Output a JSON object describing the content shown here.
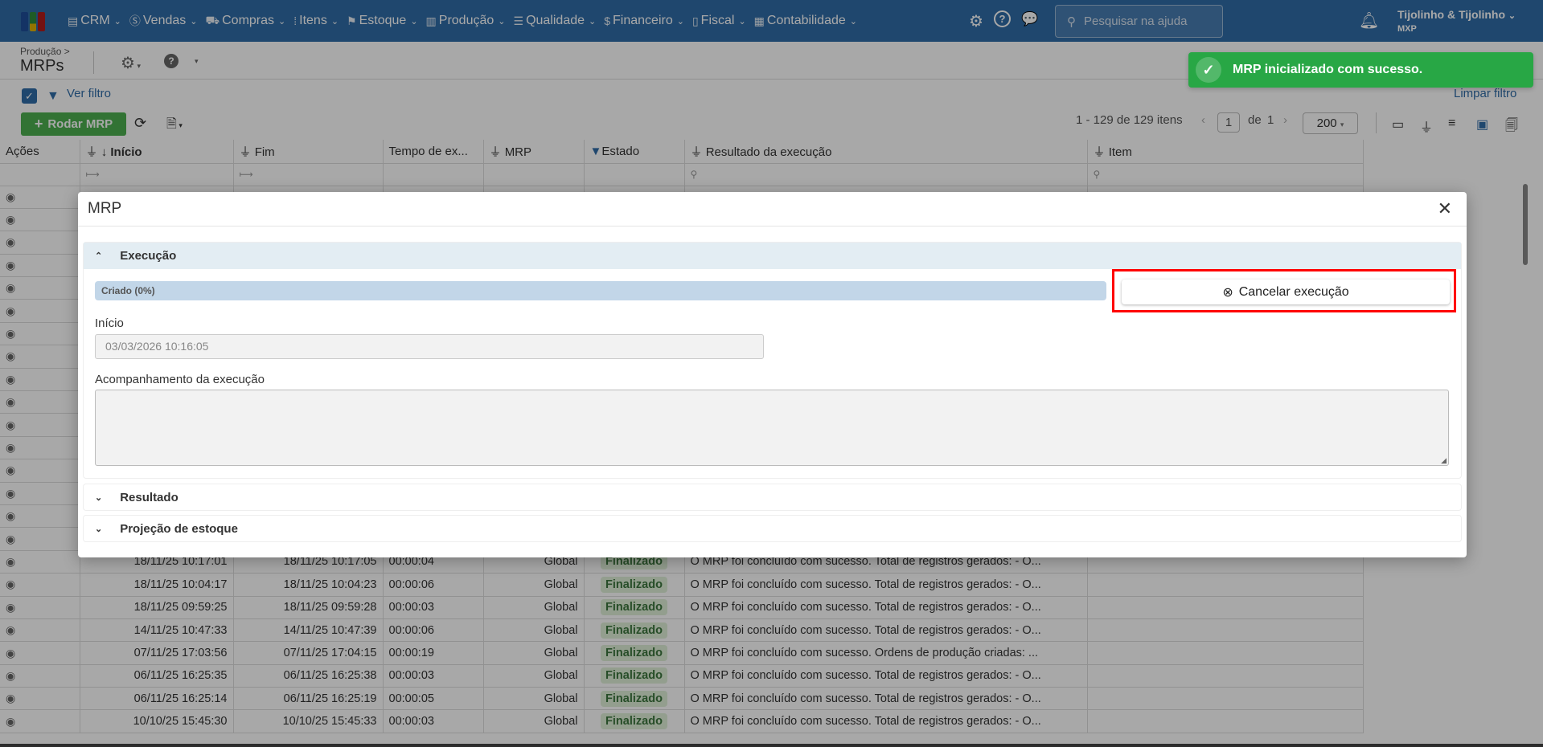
{
  "topbar": {
    "nav": [
      {
        "icon": "crm-icon",
        "glyph": "▤",
        "label": "CRM"
      },
      {
        "icon": "dollar-icon",
        "glyph": "Ⓢ",
        "label": "Vendas"
      },
      {
        "icon": "cart-icon",
        "glyph": "⛟",
        "label": "Compras"
      },
      {
        "icon": "items-icon",
        "glyph": "⁞",
        "label": "Itens"
      },
      {
        "icon": "stock-icon",
        "glyph": "⚑",
        "label": "Estoque"
      },
      {
        "icon": "factory-icon",
        "glyph": "▥",
        "label": "Produção"
      },
      {
        "icon": "checklist-icon",
        "glyph": "☰",
        "label": "Qualidade"
      },
      {
        "icon": "money-bag-icon",
        "glyph": "$",
        "label": "Financeiro"
      },
      {
        "icon": "document-icon",
        "glyph": "▯",
        "label": "Fiscal"
      },
      {
        "icon": "calculator-icon",
        "glyph": "▦",
        "label": "Contabilidade"
      }
    ],
    "search_placeholder": "Pesquisar na ajuda",
    "company": "Tijolinho & Tijolinho",
    "company_sub": "MXP"
  },
  "page": {
    "breadcrumb": "Produção >",
    "title": "MRPs",
    "ver_filtro": "Ver filtro",
    "limpar_filtro": "Limpar filtro",
    "run_button": "Rodar MRP",
    "pagination": {
      "summary": "1 - 129 de 129 itens",
      "page": "1",
      "of_label": "de",
      "total_pages": "1",
      "page_size": "200"
    }
  },
  "table": {
    "columns": [
      "Ações",
      "Início",
      "Fim",
      "Tempo de ex...",
      "MRP",
      "Estado",
      "Resultado da execução",
      "Item"
    ],
    "rows": [
      {},
      {},
      {},
      {},
      {},
      {},
      {},
      {},
      {},
      {},
      {},
      {},
      {},
      {},
      {},
      {},
      {
        "inicio": "18/11/25 10:17:01",
        "fim": "18/11/25 10:17:05",
        "tempo": "00:00:04",
        "mrp": "Global",
        "estado": "Finalizado",
        "resultado": "O MRP foi concluído com sucesso. Total de registros gerados: - O..."
      },
      {
        "inicio": "18/11/25 10:04:17",
        "fim": "18/11/25 10:04:23",
        "tempo": "00:00:06",
        "mrp": "Global",
        "estado": "Finalizado",
        "resultado": "O MRP foi concluído com sucesso. Total de registros gerados: - O..."
      },
      {
        "inicio": "18/11/25 09:59:25",
        "fim": "18/11/25 09:59:28",
        "tempo": "00:00:03",
        "mrp": "Global",
        "estado": "Finalizado",
        "resultado": "O MRP foi concluído com sucesso. Total de registros gerados: - O..."
      },
      {
        "inicio": "14/11/25 10:47:33",
        "fim": "14/11/25 10:47:39",
        "tempo": "00:00:06",
        "mrp": "Global",
        "estado": "Finalizado",
        "resultado": "O MRP foi concluído com sucesso. Total de registros gerados: - O..."
      },
      {
        "inicio": "07/11/25 17:03:56",
        "fim": "07/11/25 17:04:15",
        "tempo": "00:00:19",
        "mrp": "Global",
        "estado": "Finalizado",
        "resultado": "O MRP foi concluído com sucesso. Ordens de produção criadas: ..."
      },
      {
        "inicio": "06/11/25 16:25:35",
        "fim": "06/11/25 16:25:38",
        "tempo": "00:00:03",
        "mrp": "Global",
        "estado": "Finalizado",
        "resultado": "O MRP foi concluído com sucesso. Total de registros gerados: - O..."
      },
      {
        "inicio": "06/11/25 16:25:14",
        "fim": "06/11/25 16:25:19",
        "tempo": "00:00:05",
        "mrp": "Global",
        "estado": "Finalizado",
        "resultado": "O MRP foi concluído com sucesso. Total de registros gerados: - O..."
      },
      {
        "inicio": "10/10/25 15:45:30",
        "fim": "10/10/25 15:45:33",
        "tempo": "00:00:03",
        "mrp": "Global",
        "estado": "Finalizado",
        "resultado": "O MRP foi concluído com sucesso. Total de registros gerados: - O..."
      }
    ]
  },
  "modal": {
    "title": "MRP",
    "section_execucao": "Execução",
    "progress_label": "Criado (0%)",
    "progress_percent": 0,
    "cancel_button": "Cancelar execução",
    "inicio_label": "Início",
    "inicio_value": "03/03/2026 10:16:05",
    "acompanhamento_label": "Acompanhamento da execução",
    "section_resultado": "Resultado",
    "section_projecao": "Projeção de estoque"
  },
  "toast": {
    "message": "MRP inicializado com sucesso."
  },
  "colors": {
    "brand": "#2f6ca8",
    "success": "#28a745",
    "highlight": "#ff0000"
  }
}
